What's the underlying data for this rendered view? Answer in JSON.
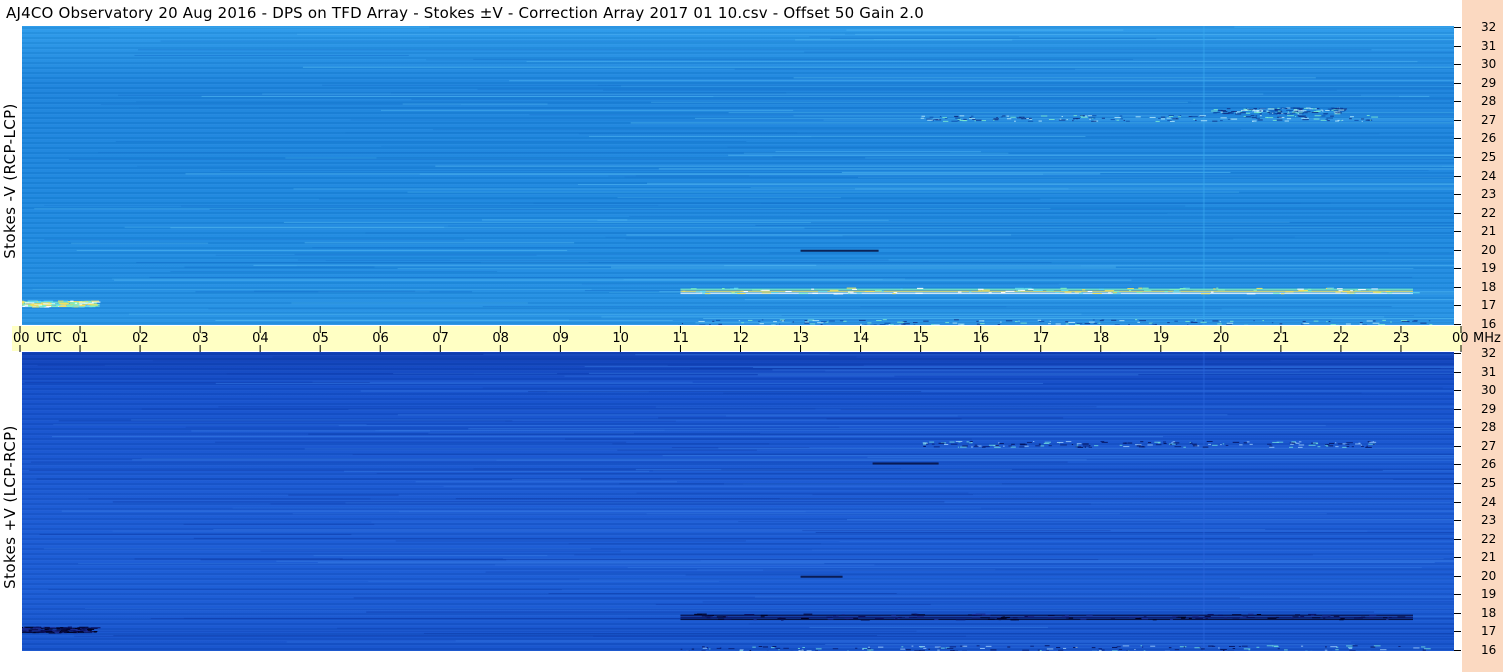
{
  "title": "AJ4CO Observatory  20 Aug 2016  -  DPS on TFD Array  -  Stokes ±V  -  Correction Array 2017 01 10.csv  -  Offset 50  Gain 2.0",
  "colors": {
    "top_panel_base": "#1e88e0",
    "bottom_panel_base": "#1552d0",
    "utc_band": "#ffffc4",
    "right_strip": "#fbd9c1"
  },
  "chart_data": [
    {
      "type": "heatmap",
      "ylabel": "Stokes -V (RCP-LCP)",
      "y_unit": "MHz",
      "yticks": [
        32,
        31,
        30,
        29,
        28,
        27,
        26,
        25,
        24,
        23,
        22,
        21,
        20,
        19,
        18,
        17,
        16
      ],
      "ylim": [
        16,
        32
      ],
      "xlim": [
        0,
        24
      ],
      "features": [
        {
          "freq": 17.8,
          "start": 11.0,
          "end": 23.2,
          "kind": "bright-band"
        },
        {
          "freq": 17.1,
          "start": 0.0,
          "end": 1.2,
          "kind": "bright-band"
        },
        {
          "freq": 27.1,
          "start": 15.0,
          "end": 22.6,
          "kind": "speckle-band"
        },
        {
          "freq": 27.5,
          "start": 19.8,
          "end": 22.0,
          "kind": "speckle-band"
        },
        {
          "freq": 20.0,
          "start": 13.0,
          "end": 14.3,
          "kind": "dark-dash"
        },
        {
          "freq": 16.1,
          "start": 11.0,
          "end": 23.5,
          "kind": "speckle-band"
        }
      ]
    },
    {
      "type": "heatmap",
      "ylabel": "Stokes +V (LCP-RCP)",
      "y_unit": "MHz",
      "yticks": [
        32,
        31,
        30,
        29,
        28,
        27,
        26,
        25,
        24,
        23,
        22,
        21,
        20,
        19,
        18,
        17,
        16
      ],
      "ylim": [
        16,
        32
      ],
      "xlim": [
        0,
        24
      ],
      "features": [
        {
          "freq": 17.8,
          "start": 11.0,
          "end": 23.2,
          "kind": "dark-band"
        },
        {
          "freq": 17.1,
          "start": 0.0,
          "end": 1.2,
          "kind": "dark-band"
        },
        {
          "freq": 27.1,
          "start": 15.0,
          "end": 22.6,
          "kind": "speckle-band"
        },
        {
          "freq": 26.1,
          "start": 14.2,
          "end": 15.3,
          "kind": "dark-dash"
        },
        {
          "freq": 20.0,
          "start": 13.0,
          "end": 13.7,
          "kind": "dark-dash"
        },
        {
          "freq": 16.1,
          "start": 11.0,
          "end": 23.5,
          "kind": "speckle-band"
        }
      ]
    }
  ],
  "x_axis": {
    "first_label": "00",
    "utc_label": "UTC",
    "labels": [
      "01",
      "02",
      "03",
      "04",
      "05",
      "06",
      "07",
      "08",
      "09",
      "10",
      "11",
      "12",
      "13",
      "14",
      "15",
      "16",
      "17",
      "18",
      "19",
      "20",
      "21",
      "22",
      "23"
    ],
    "last_label": "00",
    "mhz_label": "MHz"
  }
}
